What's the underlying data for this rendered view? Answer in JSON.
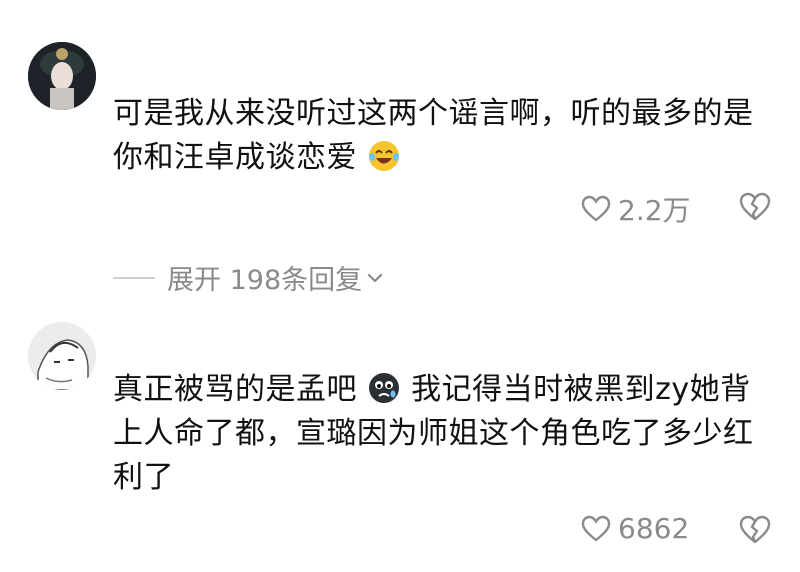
{
  "comments": [
    {
      "text": "可是我从来没听过这两个谣言啊，听的最多的是你和汪卓成谈恋爱",
      "emoji": "laughing-tears-emoji",
      "likes": "2.2万"
    },
    {
      "text_before_emoji": "真正被骂的是孟吧",
      "emoji": "sad-face-emoji",
      "text_after_emoji": "我记得当时被黑到zy她背上人命了都，宣璐因为师姐这个角色吃了多少红利了",
      "likes": "6862"
    }
  ],
  "replies": {
    "label": "展开 198条回复"
  },
  "icons": {
    "like": "heart-outline-icon",
    "dislike": "broken-heart-icon",
    "expand": "chevron-down-icon"
  },
  "colors": {
    "text": "#111111",
    "meta": "#8a8a8a",
    "divider": "#cfcfcf",
    "emoji_yellow": "#f6c431"
  }
}
